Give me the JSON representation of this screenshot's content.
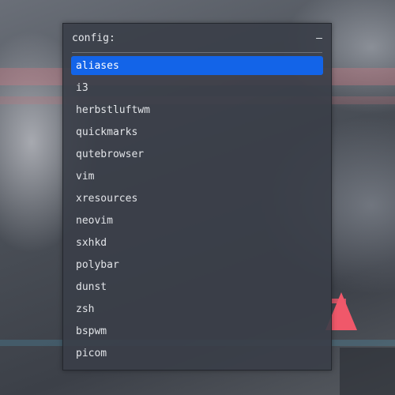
{
  "launcher": {
    "prompt": "config:",
    "query": "",
    "minimize_glyph": "–"
  },
  "colors": {
    "selection": "#1364e8",
    "panel": "#3a3e48",
    "text": "#e2e4e8",
    "accent_wallpaper": "#f0586a"
  },
  "selected_index": 0,
  "items": [
    {
      "label": "aliases"
    },
    {
      "label": "i3"
    },
    {
      "label": "herbstluftwm"
    },
    {
      "label": "quickmarks"
    },
    {
      "label": "qutebrowser"
    },
    {
      "label": "vim"
    },
    {
      "label": "xresources"
    },
    {
      "label": "neovim"
    },
    {
      "label": "sxhkd"
    },
    {
      "label": "polybar"
    },
    {
      "label": "dunst"
    },
    {
      "label": "zsh"
    },
    {
      "label": "bspwm"
    },
    {
      "label": "picom"
    }
  ]
}
